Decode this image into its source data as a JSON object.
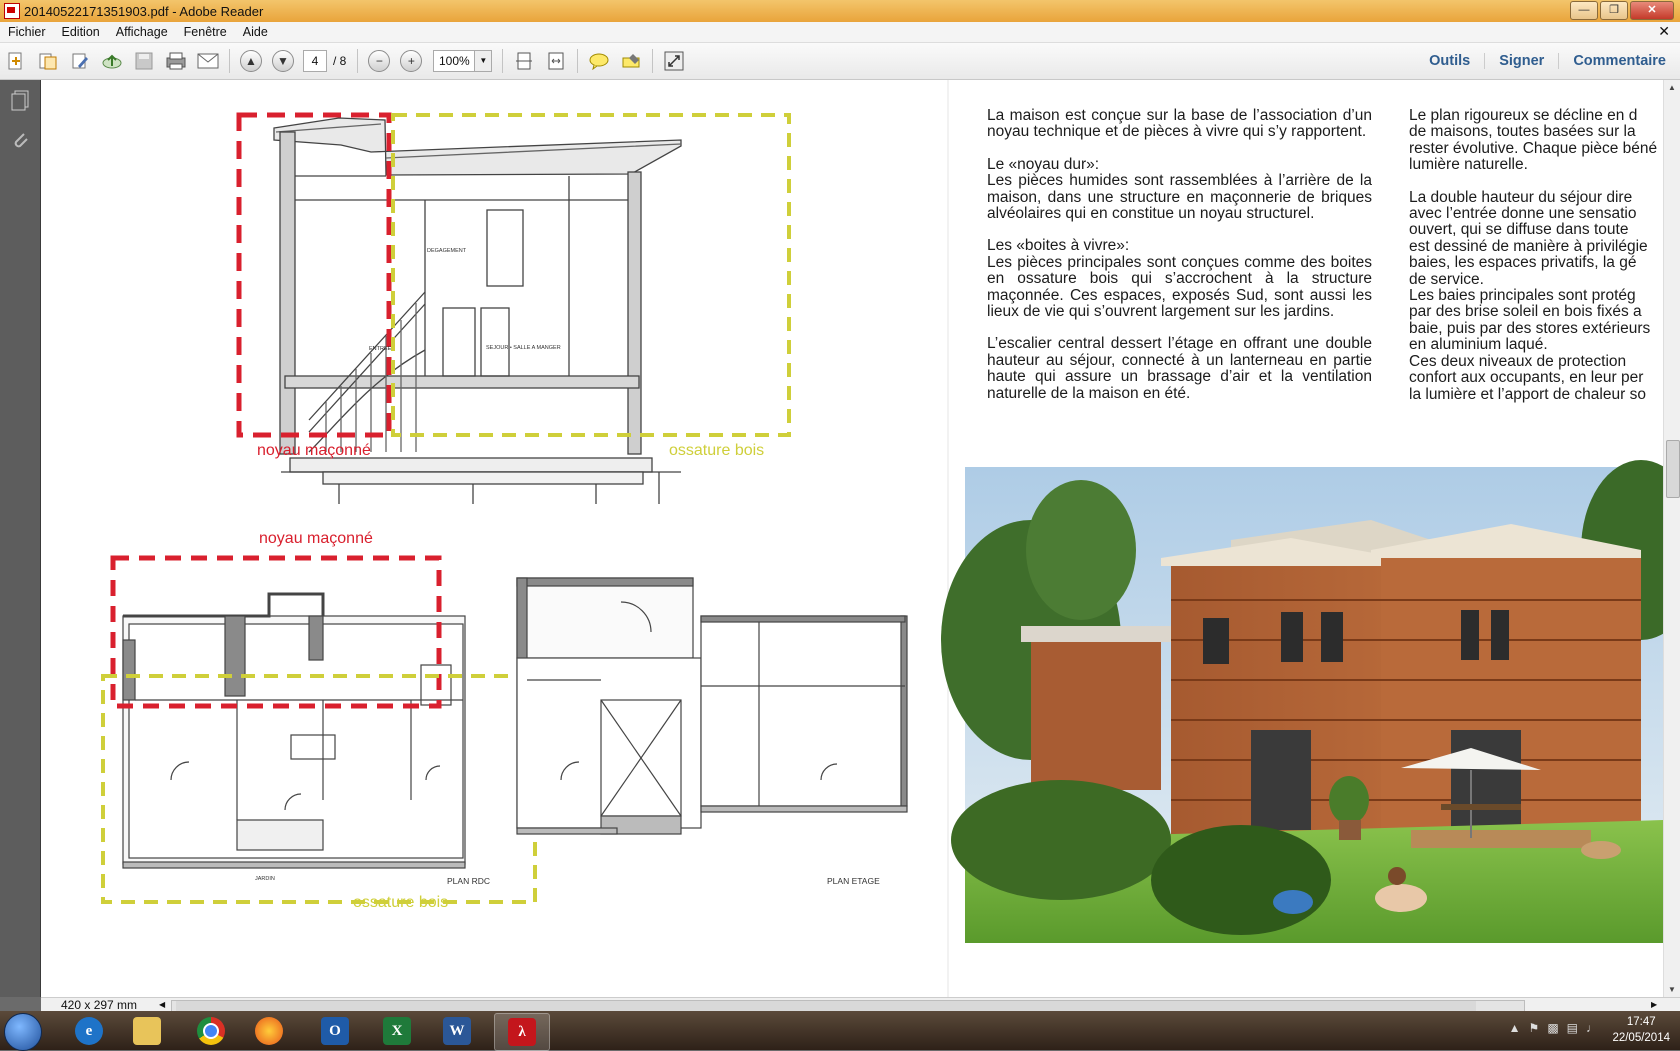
{
  "window": {
    "title": "20140522171351903.pdf - Adobe Reader"
  },
  "menu": {
    "items": [
      "Fichier",
      "Edition",
      "Affichage",
      "Fenêtre",
      "Aide"
    ]
  },
  "toolbar": {
    "page_current": "4",
    "page_total": "/ 8",
    "zoom": "100%"
  },
  "right_tools": [
    "Outils",
    "Signer",
    "Commentaire"
  ],
  "status": {
    "dimensions": "420 x 297 mm"
  },
  "document": {
    "section_labels": {
      "noyau_top": "noyau maçonné",
      "ossature_top": "ossature bois",
      "noyau_plan": "noyau maçonné",
      "ossature_plan": "ossature bois",
      "plan_rdc": "PLAN RDC",
      "plan_etage": "PLAN ETAGE",
      "degagement": "DEGAGEMENT",
      "entree": "ENTREE",
      "sejour": "SEJOUR • SALLE A MANGER",
      "jardin": "JARDIN"
    },
    "col1": [
      "La maison est conçue sur la base de l’association d’un noyau technique et de pièces à vivre qui s’y rapportent.",
      "Le «noyau dur»:",
      "Les pièces humides sont rassemblées à l’arrière de la maison, dans une structure en maçonnerie de briques alvéolaires qui en constitue un noyau structurel.",
      "Les «boites à vivre»:",
      "Les pièces principales sont conçues comme des boites en ossature bois qui s’accrochent à la structure maçonnée. Ces espaces, exposés Sud, sont aussi les lieux de vie qui s’ouvrent largement sur les jardins.",
      "L’escalier central dessert l’étage en offrant une double hauteur au séjour, connecté à un lanterneau en partie haute qui assure un brassage d’air et la ventilation naturelle de la maison en été."
    ],
    "col2": [
      "Le plan rigoureux se décline en d",
      "de maisons, toutes basées sur la",
      "rester évolutive. Chaque pièce béné",
      "lumière naturelle.",
      "La double hauteur du séjour dire",
      "avec l’entrée donne une sensatio",
      "ouvert, qui se diffuse dans toute",
      "est dessiné de manière à privilégie",
      "baies, les espaces privatifs, la gé",
      "de service.",
      "Les baies principales sont protég",
      "par des brise soleil en bois fixés a",
      "baie, puis par des stores extérieurs",
      "en aluminium laqué.",
      "Ces deux niveaux de protection",
      "confort aux occupants, en leur per",
      "la lumière et l’apport de chaleur so"
    ]
  },
  "taskbar": {
    "apps": [
      "start",
      "internet-explorer",
      "file-explorer",
      "chrome",
      "firefox",
      "outlook",
      "excel",
      "word",
      "adobe-reader"
    ],
    "time": "17:47",
    "date": "22/05/2014"
  },
  "colors": {
    "titlebar": "#e9a43b",
    "red_dash": "#d9202e",
    "yellow_dash": "#cfcf3a",
    "link": "#2f5d8f"
  }
}
